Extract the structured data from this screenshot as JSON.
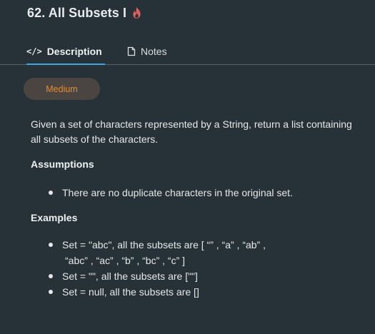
{
  "problem": {
    "title": "62. All Subsets I",
    "difficulty": "Medium"
  },
  "tabs": [
    {
      "icon": "code-icon",
      "label": "Description",
      "active": true
    },
    {
      "icon": "note-icon",
      "label": "Notes",
      "active": false
    }
  ],
  "description": {
    "paragraph": "Given a set of characters represented by a String, return a list containing all subsets of the characters.",
    "assumptions_title": "Assumptions",
    "assumptions": [
      "There are no duplicate characters in the original set."
    ],
    "examples_title": "Examples",
    "examples": [
      {
        "line1": "Set = \"abc\", all the subsets are [ “” , “a” , “ab” ,",
        "line2": "“abc” , “ac” , “b” , “bc” , “c” ]"
      },
      {
        "line1": "Set = \"\", all the subsets are [\"\"]",
        "line2": ""
      },
      {
        "line1": "Set = null, all the subsets are []",
        "line2": ""
      }
    ]
  },
  "colors": {
    "background": "#273238",
    "accent": "#3ea7df",
    "difficulty_text": "#e88a2e",
    "difficulty_bg": "#4a4540",
    "flame": "#e35f5f"
  }
}
